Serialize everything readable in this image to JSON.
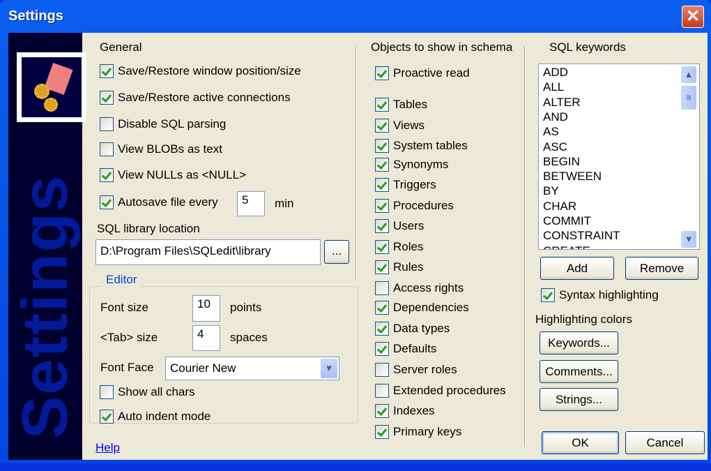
{
  "window": {
    "title": "Settings",
    "close": "✕"
  },
  "sidebar": {
    "banner": "Settings"
  },
  "general": {
    "title": "General",
    "options": [
      {
        "label": "Save/Restore window position/size",
        "checked": true
      },
      {
        "label": "Save/Restore active connections",
        "checked": true
      },
      {
        "label": "Disable SQL parsing",
        "checked": false
      },
      {
        "label": "View BLOBs as text",
        "checked": false
      },
      {
        "label": "View NULLs as <NULL>",
        "checked": true
      },
      {
        "label": "Autosave file every",
        "checked": true
      }
    ],
    "autosave_value": "5",
    "autosave_unit": "min",
    "library_label": "SQL library location",
    "library_path": "D:\\Program Files\\SQLedit\\library",
    "browse": "..."
  },
  "editor": {
    "title": "Editor",
    "font_size_label": "Font size",
    "font_size": "10",
    "font_size_unit": "points",
    "tab_label": "<Tab> size",
    "tab_size": "4",
    "tab_unit": "spaces",
    "font_face_label": "Font Face",
    "font_face": "Courier New",
    "show_all_chars": {
      "label": "Show all chars",
      "checked": false
    },
    "auto_indent": {
      "label": "Auto indent mode",
      "checked": true
    }
  },
  "help": "Help",
  "objects": {
    "title": "Objects to show in schema",
    "proactive": {
      "label": "Proactive read",
      "checked": true
    },
    "items": [
      {
        "label": "Tables",
        "checked": true
      },
      {
        "label": "Views",
        "checked": true
      },
      {
        "label": "System tables",
        "checked": true
      },
      {
        "label": "Synonyms",
        "checked": true
      },
      {
        "label": "Triggers",
        "checked": true
      },
      {
        "label": "Procedures",
        "checked": true
      },
      {
        "label": "Users",
        "checked": true
      },
      {
        "label": "Roles",
        "checked": true
      },
      {
        "label": "Rules",
        "checked": true
      },
      {
        "label": "Access rights",
        "checked": false
      },
      {
        "label": "Dependencies",
        "checked": true
      },
      {
        "label": "Data types",
        "checked": true
      },
      {
        "label": "Defaults",
        "checked": true
      },
      {
        "label": "Server roles",
        "checked": false
      },
      {
        "label": "Extended procedures",
        "checked": false
      },
      {
        "label": "Indexes",
        "checked": true
      },
      {
        "label": "Primary keys",
        "checked": true
      }
    ]
  },
  "keywords": {
    "title": "SQL keywords",
    "items": [
      "ADD",
      "ALL",
      "ALTER",
      "AND",
      "AS",
      "ASC",
      "BEGIN",
      "BETWEEN",
      "BY",
      "CHAR",
      "COMMIT",
      "CONSTRAINT",
      "CREATE"
    ],
    "add": "Add",
    "remove": "Remove",
    "syntax": {
      "label": "Syntax highlighting",
      "checked": true
    },
    "colors_label": "Highlighting colors",
    "colors": [
      "Keywords...",
      "Comments...",
      "Strings..."
    ]
  },
  "footer": {
    "ok": "OK",
    "cancel": "Cancel"
  }
}
